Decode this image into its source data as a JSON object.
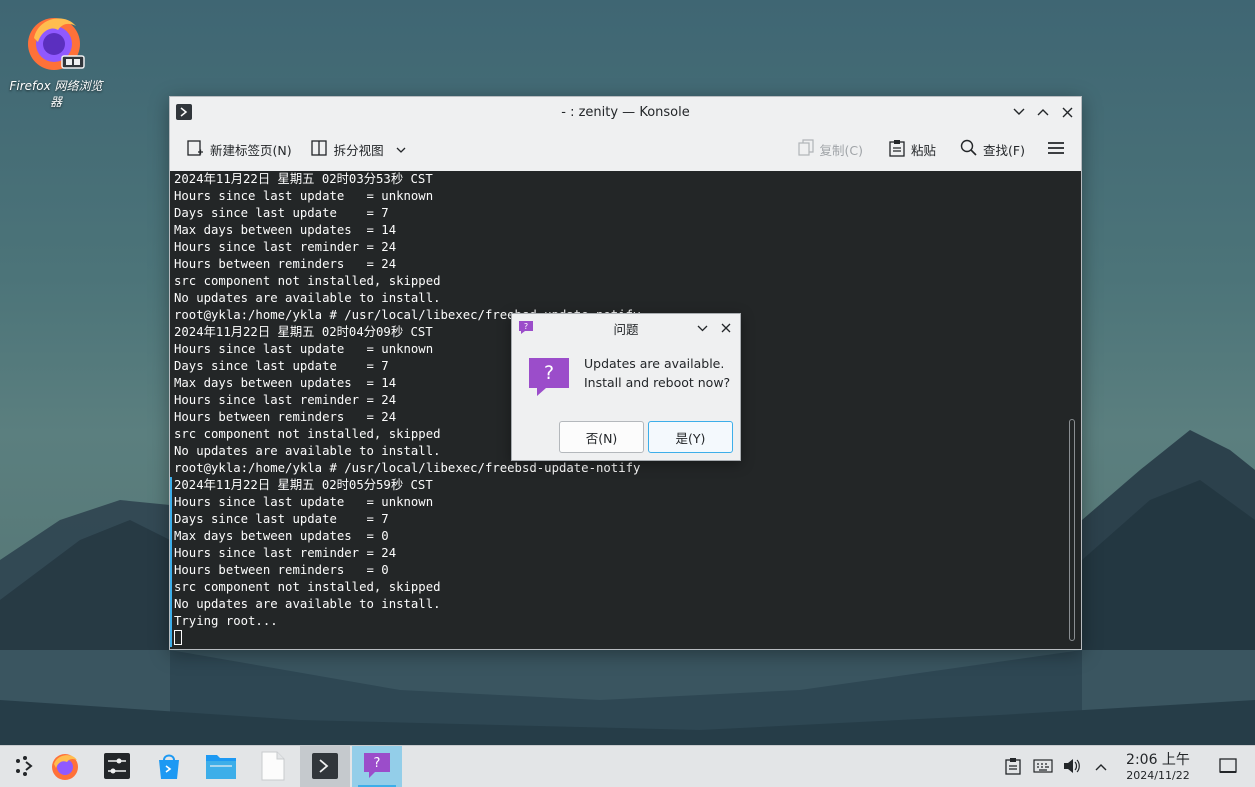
{
  "desktop": {
    "icons": [
      {
        "label": "Firefox 网络浏览器",
        "icon": "firefox-icon"
      }
    ]
  },
  "konsole": {
    "title": "- : zenity — Konsole",
    "toolbar": {
      "new_tab": "新建标签页(N)",
      "split_view": "拆分视图",
      "copy": "复制(C)",
      "paste": "粘贴",
      "find": "查找(F)"
    },
    "terminal_lines": [
      "2024年11月22日 星期五 02时03分53秒 CST",
      "Hours since last update   = unknown",
      "Days since last update    = 7",
      "Max days between updates  = 14",
      "Hours since last reminder = 24",
      "Hours between reminders   = 24",
      "src component not installed, skipped",
      "No updates are available to install.",
      "root@ykla:/home/ykla # /usr/local/libexec/freebsd-update-notify",
      "2024年11月22日 星期五 02时04分09秒 CST",
      "Hours since last update   = unknown",
      "Days since last update    = 7",
      "Max days between updates  = 14",
      "Hours since last reminder = 24",
      "Hours between reminders   = 24",
      "src component not installed, skipped",
      "No updates are available to install.",
      "root@ykla:/home/ykla # /usr/local/libexec/freebsd-update-notify",
      "2024年11月22日 星期五 02时05分59秒 CST",
      "Hours since last update   = unknown",
      "Days since last update    = 7",
      "Max days between updates  = 0",
      "Hours since last reminder = 24",
      "Hours between reminders   = 0",
      "src component not installed, skipped",
      "No updates are available to install.",
      "Trying root..."
    ]
  },
  "dialog": {
    "title": "问题",
    "message_line1": "Updates are available.",
    "message_line2": "Install and reboot now?",
    "no_button": "否(N)",
    "yes_button": "是(Y)"
  },
  "taskbar": {
    "apps": [
      "application-launcher",
      "firefox",
      "system-settings",
      "discover",
      "dolphin",
      "text-editor",
      "konsole",
      "zenity-question"
    ],
    "clock_time": "2:06 上午",
    "clock_date": "2024/11/22"
  },
  "colors": {
    "accent": "#3daee9",
    "terminal_bg": "#232627",
    "dialog_icon": "#9b4dca"
  }
}
